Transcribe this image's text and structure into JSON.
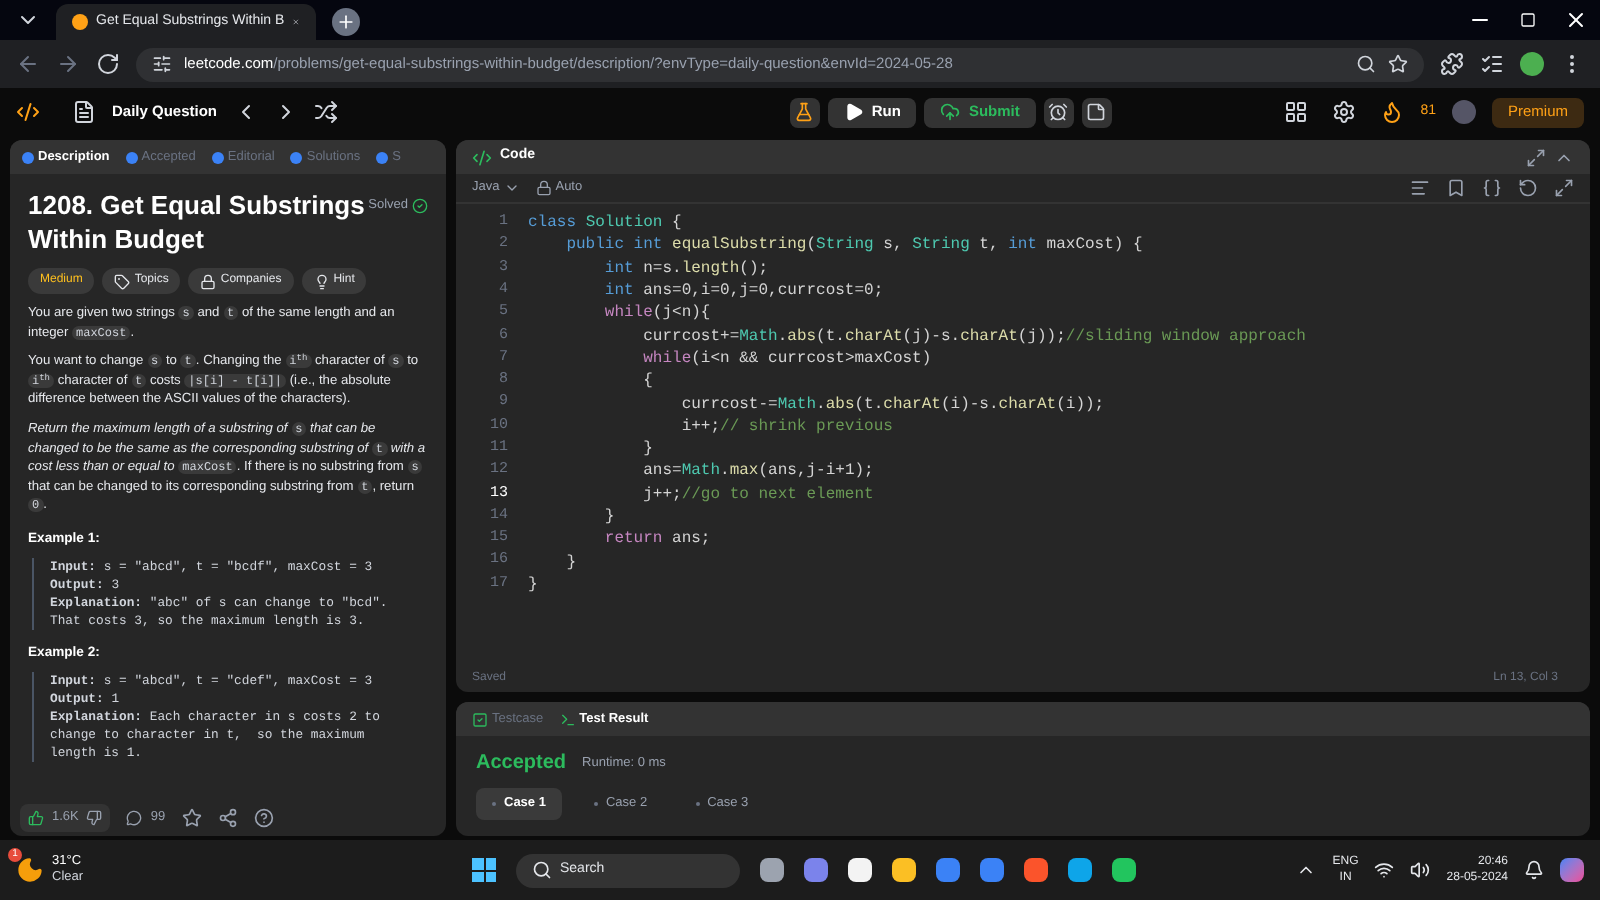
{
  "browser": {
    "tab_title": "Get Equal Substrings Within B",
    "url_domain": "leetcode.com",
    "url_path": "/problems/get-equal-substrings-within-budget/description/?envType=daily-question&envId=2024-05-28"
  },
  "nav": {
    "daily": "Daily Question",
    "run": "Run",
    "submit": "Submit",
    "streak": "81",
    "premium": "Premium"
  },
  "desc_tabs": [
    {
      "label": "Description",
      "selected": true
    },
    {
      "label": "Accepted",
      "selected": false
    },
    {
      "label": "Editorial",
      "selected": false
    },
    {
      "label": "Solutions",
      "selected": false
    },
    {
      "label": "S",
      "selected": false
    }
  ],
  "problem": {
    "title": "1208. Get Equal Substrings Within Budget",
    "status": "Solved",
    "difficulty": "Medium",
    "tags": [
      "Topics",
      "Companies",
      "Hint"
    ],
    "paragraphs": [
      {
        "italic": false,
        "segments": [
          {
            "kind": "text",
            "text": "You are given two strings "
          },
          {
            "kind": "code",
            "text": "s"
          },
          {
            "kind": "text",
            "text": " and "
          },
          {
            "kind": "code",
            "text": "t"
          },
          {
            "kind": "text",
            "text": " of the same length and an integer "
          },
          {
            "kind": "code",
            "text": "maxCost"
          },
          {
            "kind": "text",
            "text": "."
          }
        ]
      },
      {
        "italic": false,
        "segments": [
          {
            "kind": "text",
            "text": "You want to change "
          },
          {
            "kind": "code",
            "text": "s"
          },
          {
            "kind": "text",
            "text": " to "
          },
          {
            "kind": "code",
            "text": "t"
          },
          {
            "kind": "text",
            "text": ". Changing the "
          },
          {
            "kind": "code",
            "text": "i$^{th}$"
          },
          {
            "kind": "text",
            "text": " character of "
          },
          {
            "kind": "code",
            "text": "s"
          },
          {
            "kind": "text",
            "text": " to "
          },
          {
            "kind": "code",
            "text": "i$^{th}$"
          },
          {
            "kind": "text",
            "text": " character of "
          },
          {
            "kind": "code",
            "text": "t"
          },
          {
            "kind": "text",
            "text": " costs "
          },
          {
            "kind": "code",
            "text": "|s[i] - t[i]|"
          },
          {
            "kind": "text",
            "text": " (i.e., the absolute difference between the ASCII values of the characters)."
          }
        ]
      },
      {
        "italic": true,
        "segments": [
          {
            "kind": "text",
            "text": "Return the maximum length of a substring of "
          },
          {
            "kind": "code",
            "text": "s"
          },
          {
            "kind": "text",
            "text": " that can be changed to be the same as the corresponding substring of "
          },
          {
            "kind": "code",
            "text": "t"
          },
          {
            "kind": "text",
            "text": " with a cost less than or equal to "
          },
          {
            "kind": "code",
            "text": "maxCost"
          },
          {
            "kind": "plain",
            "text": ". If there is no substring from "
          },
          {
            "kind": "code",
            "text": "s"
          },
          {
            "kind": "plain",
            "text": " that can be changed to its corresponding substring from "
          },
          {
            "kind": "code",
            "text": "t"
          },
          {
            "kind": "plain",
            "text": ", return "
          },
          {
            "kind": "code",
            "text": "0"
          },
          {
            "kind": "plain",
            "text": "."
          }
        ]
      }
    ],
    "examples": [
      {
        "title": "Example 1:",
        "lines": [
          "**Input:** s = \"abcd\", t = \"bcdf\", maxCost = 3",
          "**Output:** 3",
          "**Explanation:** \"abc\" of s can change to \"bcd\".",
          "That costs 3, so the maximum length is 3."
        ]
      },
      {
        "title": "Example 2:",
        "lines": [
          "**Input:** s = \"abcd\", t = \"cdef\", maxCost = 3",
          "**Output:** 1",
          "**Explanation:** Each character in s costs 2 to",
          "change to character in t,  so the maximum",
          "length is 1."
        ]
      }
    ],
    "likes": "1.6K",
    "comments": "99"
  },
  "editor": {
    "title": "Code",
    "language": "Java",
    "mode": "Auto",
    "status": "Saved",
    "cursor": "Ln 13, Col 3",
    "lines": [
      {
        "number": "1",
        "active": false,
        "tokens": [
          {
            "kind": "kw",
            "text": "class "
          },
          {
            "kind": "type",
            "text": "Solution"
          },
          {
            "kind": "plain",
            "text": " {"
          }
        ]
      },
      {
        "number": "2",
        "active": false,
        "tokens": [
          {
            "kind": "kw",
            "text": "    public int "
          },
          {
            "kind": "fn",
            "text": "equalSubstring"
          },
          {
            "kind": "plain",
            "text": "("
          },
          {
            "kind": "type",
            "text": "String"
          },
          {
            "kind": "plain",
            "text": " s, "
          },
          {
            "kind": "type",
            "text": "String"
          },
          {
            "kind": "plain",
            "text": " t, "
          },
          {
            "kind": "kw",
            "text": "int"
          },
          {
            "kind": "plain",
            "text": " maxCost) {"
          }
        ]
      },
      {
        "number": "3",
        "active": false,
        "tokens": [
          {
            "kind": "kw",
            "text": "        int"
          },
          {
            "kind": "plain",
            "text": " n=s."
          },
          {
            "kind": "fn",
            "text": "length"
          },
          {
            "kind": "plain",
            "text": "();"
          }
        ]
      },
      {
        "number": "4",
        "active": false,
        "tokens": [
          {
            "kind": "kw",
            "text": "        int"
          },
          {
            "kind": "plain",
            "text": " ans=0,i=0,j=0,currcost=0;"
          }
        ]
      },
      {
        "number": "5",
        "active": false,
        "tokens": [
          {
            "kind": "ctl",
            "text": "        while"
          },
          {
            "kind": "plain",
            "text": "(j<n){"
          }
        ]
      },
      {
        "number": "6",
        "active": false,
        "tokens": [
          {
            "kind": "plain",
            "text": "            currcost+="
          },
          {
            "kind": "type",
            "text": "Math"
          },
          {
            "kind": "plain",
            "text": "."
          },
          {
            "kind": "fn",
            "text": "abs"
          },
          {
            "kind": "plain",
            "text": "(t."
          },
          {
            "kind": "fn",
            "text": "charAt"
          },
          {
            "kind": "plain",
            "text": "(j)-s."
          },
          {
            "kind": "fn",
            "text": "charAt"
          },
          {
            "kind": "plain",
            "text": "(j));"
          },
          {
            "kind": "comment",
            "text": "//sliding window approach"
          }
        ]
      },
      {
        "number": "7",
        "active": false,
        "tokens": [
          {
            "kind": "ctl",
            "text": "            while"
          },
          {
            "kind": "plain",
            "text": "(i<n && currcost>maxCost)"
          }
        ]
      },
      {
        "number": "8",
        "active": false,
        "tokens": [
          {
            "kind": "plain",
            "text": "            {"
          }
        ]
      },
      {
        "number": "9",
        "active": false,
        "tokens": [
          {
            "kind": "plain",
            "text": "                currcost-="
          },
          {
            "kind": "type",
            "text": "Math"
          },
          {
            "kind": "plain",
            "text": "."
          },
          {
            "kind": "fn",
            "text": "abs"
          },
          {
            "kind": "plain",
            "text": "(t."
          },
          {
            "kind": "fn",
            "text": "charAt"
          },
          {
            "kind": "plain",
            "text": "(i)-s."
          },
          {
            "kind": "fn",
            "text": "charAt"
          },
          {
            "kind": "plain",
            "text": "(i));"
          }
        ]
      },
      {
        "number": "10",
        "active": false,
        "tokens": [
          {
            "kind": "plain",
            "text": "                i++;"
          },
          {
            "kind": "comment",
            "text": "// shrink previous"
          }
        ]
      },
      {
        "number": "11",
        "active": false,
        "tokens": [
          {
            "kind": "plain",
            "text": "            }"
          }
        ]
      },
      {
        "number": "12",
        "active": false,
        "tokens": [
          {
            "kind": "plain",
            "text": "            ans="
          },
          {
            "kind": "type",
            "text": "Math"
          },
          {
            "kind": "plain",
            "text": "."
          },
          {
            "kind": "fn",
            "text": "max"
          },
          {
            "kind": "plain",
            "text": "(ans,j-i+1);"
          }
        ]
      },
      {
        "number": "13",
        "active": true,
        "tokens": [
          {
            "kind": "plain",
            "text": "            j++;"
          },
          {
            "kind": "comment",
            "text": "//go to next element"
          }
        ]
      },
      {
        "number": "14",
        "active": false,
        "tokens": [
          {
            "kind": "plain",
            "text": "        }"
          }
        ]
      },
      {
        "number": "15",
        "active": false,
        "tokens": [
          {
            "kind": "ctl",
            "text": "        return"
          },
          {
            "kind": "plain",
            "text": " ans;"
          }
        ]
      },
      {
        "number": "16",
        "active": false,
        "tokens": [
          {
            "kind": "plain",
            "text": "    }"
          }
        ]
      },
      {
        "number": "17",
        "active": false,
        "tokens": [
          {
            "kind": "plain",
            "text": "}"
          }
        ]
      }
    ]
  },
  "result": {
    "tabs": [
      {
        "label": "Testcase",
        "selected": false
      },
      {
        "label": "Test Result",
        "selected": true
      }
    ],
    "verdict": "Accepted",
    "runtime": "Runtime: 0 ms",
    "cases": [
      {
        "label": "Case 1",
        "selected": true
      },
      {
        "label": "Case 2",
        "selected": false
      },
      {
        "label": "Case 3",
        "selected": false
      }
    ]
  },
  "taskbar": {
    "temperature": "31°C",
    "weather": "Clear",
    "weather_badge": "1",
    "search": "Search",
    "lang_top": "ENG",
    "lang_bottom": "IN",
    "time": "20:46",
    "date": "28-05-2024"
  }
}
